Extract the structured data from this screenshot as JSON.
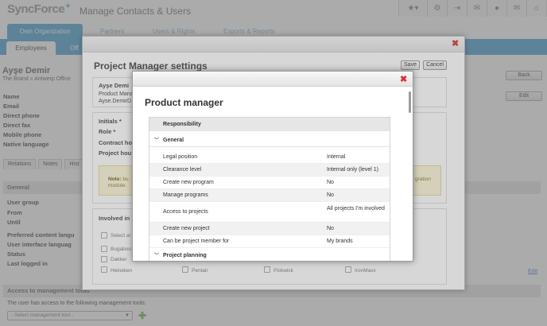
{
  "header": {
    "logo_text": "SyncForce",
    "logo_plus": "+",
    "app_title": "Manage Contacts & Users",
    "toolbar": [
      {
        "name": "star-icon",
        "glyph": "★▾"
      },
      {
        "name": "gear-icon",
        "glyph": "⚙"
      },
      {
        "name": "signout-icon",
        "glyph": "⇥"
      },
      {
        "name": "inbox-icon",
        "glyph": "✉"
      },
      {
        "name": "user-icon",
        "glyph": "●"
      },
      {
        "name": "mail-icon",
        "glyph": "✉"
      },
      {
        "name": "home-icon",
        "glyph": "⌂"
      }
    ]
  },
  "nav": {
    "tabs": [
      {
        "label": "Own Organization"
      },
      {
        "label": "Partners"
      },
      {
        "label": "Users & Rights"
      },
      {
        "label": "Exports & Reports"
      }
    ],
    "subtabs": [
      {
        "label": "Employees"
      },
      {
        "label": "Off"
      }
    ]
  },
  "contact": {
    "name": "Ayşe Demir",
    "org": "The Brand » Antwerp Office",
    "fields": [
      "Name",
      "Email",
      "Direct phone",
      "Direct fax",
      "Mobile phone",
      "Native language"
    ],
    "back_label": "Back",
    "edit_label": "Edit"
  },
  "page_tabs": [
    {
      "label": "Relations"
    },
    {
      "label": "Notes"
    },
    {
      "label": "Hist"
    }
  ],
  "general": {
    "section_title": "General",
    "fields": [
      "User group",
      "From",
      "Until",
      "Preferred content langu",
      "User interface languag",
      "Status",
      "Last logged in"
    ],
    "edit_link": "Edit"
  },
  "management": {
    "section_title": "Access to management tools",
    "text": "The user has access to the following management tools:",
    "select_placeholder": "- Select management tool -",
    "add_icon": "✚"
  },
  "modal1": {
    "title": "Project Manager settings",
    "close": "✖",
    "save_label": "Save",
    "cancel_label": "Cancel",
    "person_name": "Ayşe Demi",
    "person_role": "Product Mana",
    "person_email": "Ayse.DemirD",
    "initials_label": "Initials *",
    "role_label": "Role *",
    "contract_label": "Contract ho",
    "project_hours_label": "Project hou",
    "note_prefix": "Note:",
    "note_text": "bu",
    "note_right": "gration",
    "note_line2": "module.",
    "involved_label": "Involved in",
    "select_all": "Select al",
    "brands_row1": [
      "Bugaboo"
    ],
    "brands_row2": [
      "Dakker"
    ],
    "brands_row3": [
      "Heineken",
      "Pentair",
      "Pickwick",
      "IronMaxx"
    ]
  },
  "modal2": {
    "title": "Product manager",
    "close": "✖",
    "table": {
      "header": "Responsibility",
      "group_general": "General",
      "rows": [
        {
          "label": "Legal position",
          "value": "Internal"
        },
        {
          "label": "Clearance level",
          "value": "Internal only (level 1)"
        },
        {
          "label": "Create new program",
          "value": "No"
        },
        {
          "label": "Manage programs",
          "value": "No"
        },
        {
          "label": "Access to projects",
          "value": "All projects I'm involved"
        },
        {
          "label": "Create new project",
          "value": "No"
        },
        {
          "label": "Can be project member for",
          "value": "My brands"
        }
      ],
      "group_planning": "Project planning"
    }
  },
  "colors": {
    "accent": "#3b9ccf",
    "close_red": "#d9312f",
    "note_bg": "#fbf6d6",
    "add_green": "#5ab642"
  }
}
